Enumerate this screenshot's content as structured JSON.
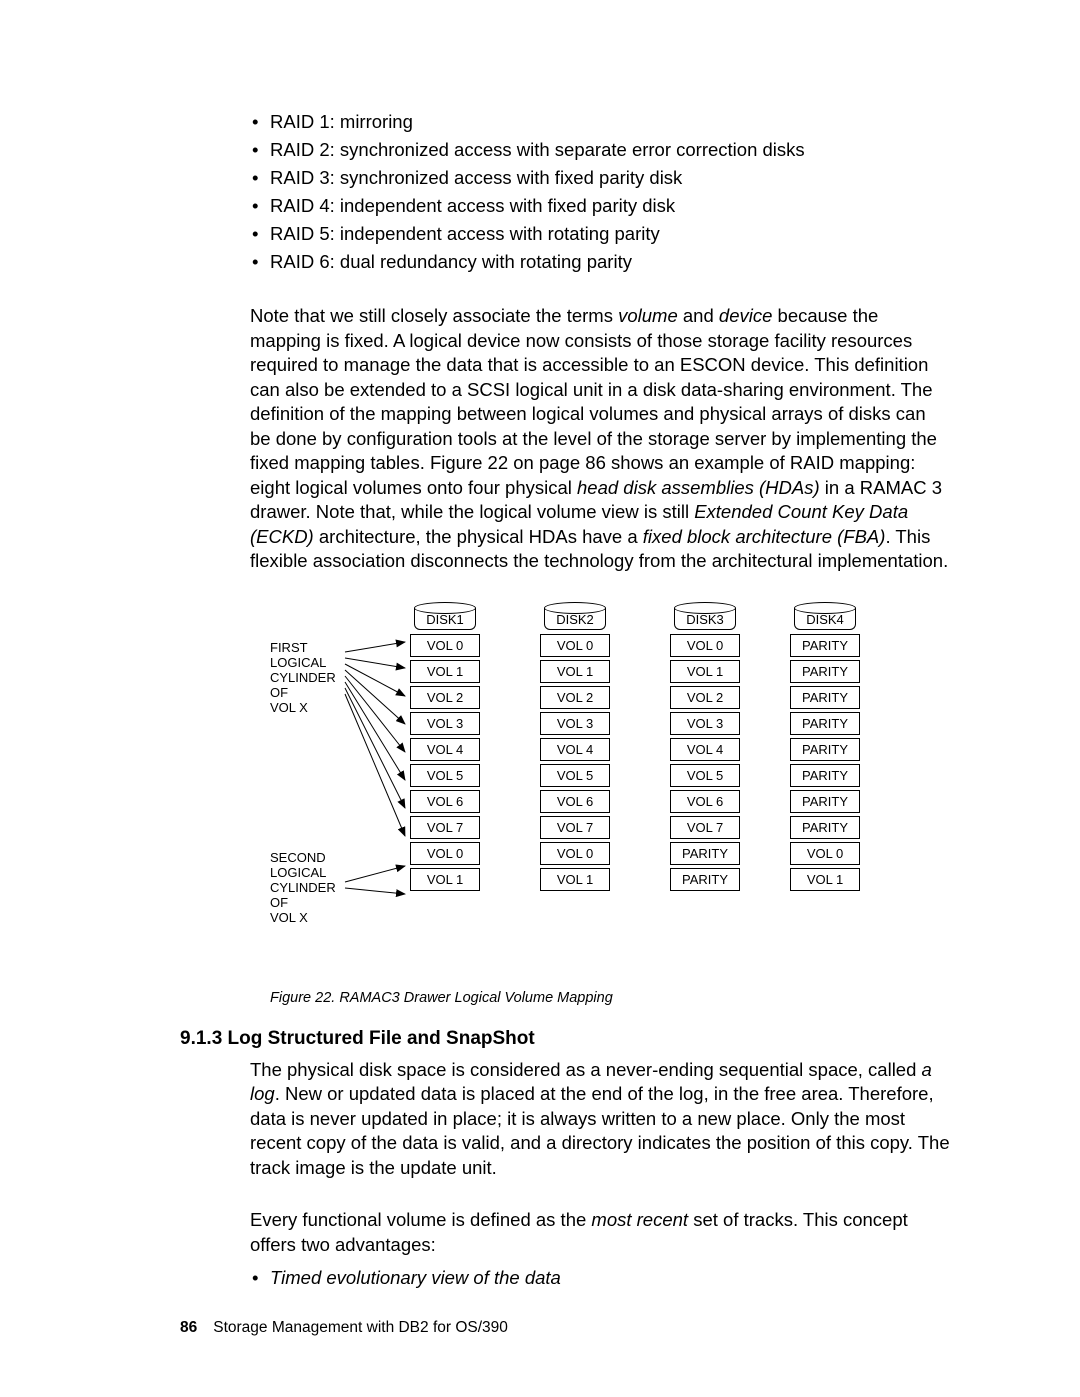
{
  "raid_list": [
    "RAID 1: mirroring",
    "RAID 2: synchronized access with separate error correction disks",
    "RAID 3: synchronized access with fixed parity disk",
    "RAID 4: independent access with fixed parity disk",
    "RAID 5: independent access with rotating parity",
    "RAID 6: dual redundancy with rotating parity"
  ],
  "para1_parts": [
    "Note that we still closely associate the terms ",
    "volume",
    " and ",
    "device",
    " because the mapping is fixed. A logical device now consists of those storage facility resources required to manage the data that is accessible to an ESCON device. This definition can also be extended to a SCSI logical unit in a disk data-sharing environment. The definition of the mapping between logical volumes and physical arrays of disks can be done by configuration tools at the level of the storage server by implementing the fixed mapping tables. Figure 22 on page 86 shows an example of RAID mapping: eight logical volumes onto four physical ",
    "head disk assemblies (HDAs)",
    " in a RAMAC 3 drawer. Note that, while the logical volume view is still ",
    "Extended Count Key Data (ECKD)",
    " architecture, the physical HDAs have a ",
    "fixed block architecture (FBA)",
    ". This flexible association disconnects the technology from the architectural implementation."
  ],
  "figure": {
    "side_label_1": "FIRST\nLOGICAL\nCYLINDER\nOF\nVOL X",
    "side_label_2": "SECOND\nLOGICAL\nCYLINDER\nOF\nVOL X",
    "disks": [
      "DISK1",
      "DISK2",
      "DISK3",
      "DISK4"
    ],
    "cols": [
      [
        "VOL 0",
        "VOL 1",
        "VOL 2",
        "VOL 3",
        "VOL 4",
        "VOL 5",
        "VOL 6",
        "VOL 7",
        "VOL 0",
        "VOL 1"
      ],
      [
        "VOL 0",
        "VOL 1",
        "VOL 2",
        "VOL 3",
        "VOL 4",
        "VOL 5",
        "VOL 6",
        "VOL 7",
        "VOL 0",
        "VOL 1"
      ],
      [
        "VOL 0",
        "VOL 1",
        "VOL 2",
        "VOL 3",
        "VOL 4",
        "VOL 5",
        "VOL 6",
        "VOL 7",
        "PARITY",
        "PARITY"
      ],
      [
        "PARITY",
        "PARITY",
        "PARITY",
        "PARITY",
        "PARITY",
        "PARITY",
        "PARITY",
        "PARITY",
        "VOL 0",
        "VOL 1"
      ]
    ],
    "caption": "Figure 22. RAMAC3 Drawer Logical Volume Mapping"
  },
  "section_heading": "9.1.3  Log Structured File and SnapShot",
  "para2_parts": [
    "The physical disk space is considered as a never-ending sequential space, called ",
    "a log",
    ". New or updated data is placed at the end of the log, in the free area. Therefore, data is never updated in place; it is always written to a new place. Only the most recent copy of the data is valid, and a directory indicates the position of this copy. The track image is the update unit."
  ],
  "para3_parts": [
    "Every functional volume is defined as the ",
    "most recent",
    " set of tracks. This concept offers two advantages:"
  ],
  "advantages": [
    "Timed evolutionary view of the data"
  ],
  "footer": {
    "page": "86",
    "title": "Storage Management with DB2 for OS/390"
  }
}
